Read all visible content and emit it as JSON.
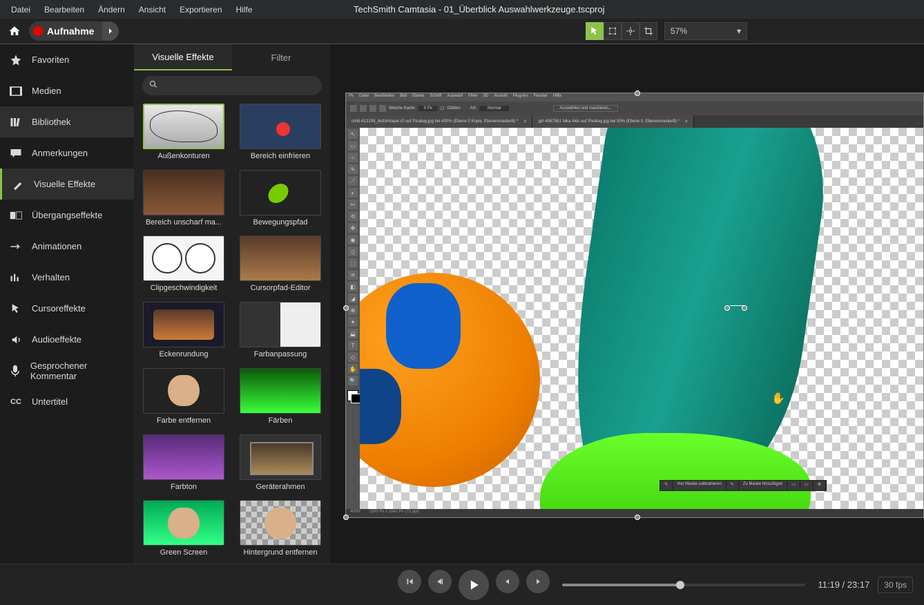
{
  "app_title": "TechSmith Camtasia - 01_Überblick Auswahlwerkzeuge.tscproj",
  "menu": [
    "Datei",
    "Bearbeiten",
    "Ändern",
    "Ansicht",
    "Exportieren",
    "Hilfe"
  ],
  "record_label": "Aufnahme",
  "zoom": "57%",
  "sidebar": [
    {
      "label": "Favoriten"
    },
    {
      "label": "Medien"
    },
    {
      "label": "Bibliothek"
    },
    {
      "label": "Anmerkungen"
    },
    {
      "label": "Visuelle Effekte"
    },
    {
      "label": "Übergangseffekte"
    },
    {
      "label": "Animationen"
    },
    {
      "label": "Verhalten"
    },
    {
      "label": "Cursoreffekte"
    },
    {
      "label": "Audioeffekte"
    },
    {
      "label": "Gesprochener Kommentar"
    },
    {
      "label": "Untertitel"
    }
  ],
  "sidebar_active": 4,
  "effect_tabs": [
    "Visuelle Effekte",
    "Filter"
  ],
  "effect_tab_active": 0,
  "search_placeholder": "",
  "effects": [
    {
      "label": "Außenkonturen",
      "th": "th-outline",
      "sel": true
    },
    {
      "label": "Bereich einfrieren",
      "th": "th-freeze"
    },
    {
      "label": "Bereich unscharf ma...",
      "th": "th-blur"
    },
    {
      "label": "Bewegungspfad",
      "th": "th-motion"
    },
    {
      "label": "Clipgeschwindigkeit",
      "th": "th-clocks"
    },
    {
      "label": "Cursorpfad-Editor",
      "th": "th-cursor"
    },
    {
      "label": "Eckenrundung",
      "th": "th-corner"
    },
    {
      "label": "Farbanpassung",
      "th": "th-coloradj"
    },
    {
      "label": "Farbe entfernen",
      "th": "th-colorrem"
    },
    {
      "label": "Färben",
      "th": "th-colorize"
    },
    {
      "label": "Farbton",
      "th": "th-hue"
    },
    {
      "label": "Geräterahmen",
      "th": "th-device"
    },
    {
      "label": "Green Screen",
      "th": "th-green"
    },
    {
      "label": "Hintergrund entfernen",
      "th": "th-bgrem"
    }
  ],
  "ps": {
    "menu": [
      "Ps",
      "Datei",
      "Bearbeiten",
      "Bild",
      "Ebene",
      "Schrift",
      "Auswahl",
      "Filter",
      "3D",
      "Ansicht",
      "Plug-ins",
      "Fenster",
      "Hilfe"
    ],
    "opt_weichekante": "Weiche Kante:",
    "opt_px": "0 Px",
    "opt_glatten": "Glätten",
    "opt_art": "Art:",
    "opt_normal": "Normal",
    "opt_select_mask": "Auswählen und maskieren...",
    "tabs": [
      "child-613199_bottomlayer.c0 auf Pixabay.jpg bei 400% (Ebene 0 Kopie, Ebenenmaske/8) *",
      "girl-4567561 Nika Akin auf Pixabay.jpg bei 50% (Ebene 0, Ebenenmaske/8) *"
    ],
    "status_zoom": "400%",
    "status_dims": "1500 Px x 1042 Px (72 ppi)",
    "float_sub": "Von Maske subtrahieren",
    "float_add": "Zu Maske hinzufügen"
  },
  "playback": {
    "time": "11:19 / 23:17",
    "fps": "30 fps"
  }
}
